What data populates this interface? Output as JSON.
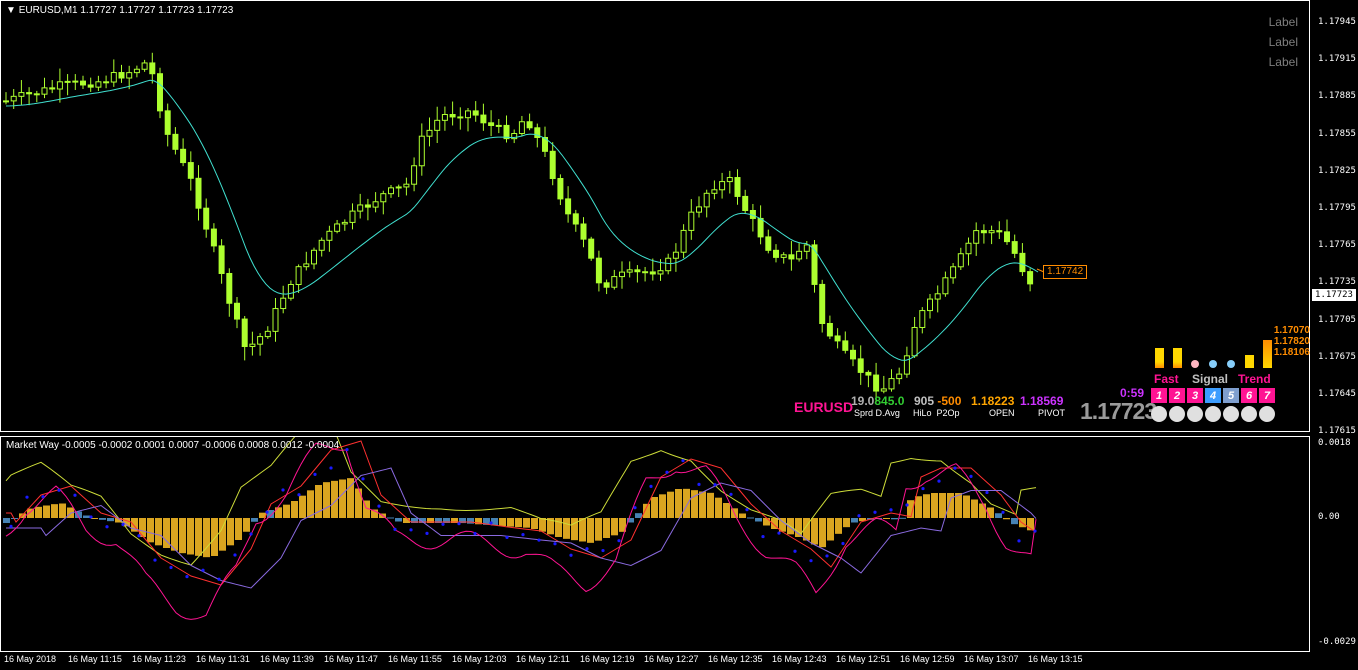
{
  "main_header": {
    "arrow": "▼",
    "text": "EURUSD,M1  1.17727 1.17727 1.17723 1.17723"
  },
  "sub_header": {
    "text": "Market Way -0.0005 -0.0002 0.0001 0.0007 -0.0006 0.0008 0.0012 -0.0004"
  },
  "labels": [
    "Label",
    "Label",
    "Label"
  ],
  "price_axis": [
    "1.17945",
    "1.17915",
    "1.17885",
    "1.17855",
    "1.17825",
    "1.17795",
    "1.17765",
    "1.17735",
    "1.17705",
    "1.17675",
    "1.17645",
    "1.17615"
  ],
  "current_price": "1.17723",
  "sub_axis": [
    "0.0018",
    "0.00",
    "-0.0029"
  ],
  "time_axis": [
    "16 May 2018",
    "16 May 11:15",
    "16 May 11:23",
    "16 May 11:31",
    "16 May 11:39",
    "16 May 11:47",
    "16 May 11:55",
    "16 May 12:03",
    "16 May 12:11",
    "16 May 12:19",
    "16 May 12:27",
    "16 May 12:35",
    "16 May 12:43",
    "16 May 12:51",
    "16 May 12:59",
    "16 May 13:07",
    "16 May 13:15"
  ],
  "price_tag": "1.17742",
  "info_panel": {
    "symbol": "EURUSD",
    "sprd_value": "19.0",
    "davg_value": "845.0",
    "sprd_label": "Sprd",
    "davg_label": "D.Avg",
    "hilo_value": "905",
    "p2op_value": "-500",
    "hilo_label": "HiLo",
    "p2op_label": "P2Op",
    "open_value": "1.18223",
    "open_label": "OPEN",
    "pivot_value": "1.18569",
    "pivot_label": "PIVOT",
    "timer": "0:59",
    "big_price": "1.17723"
  },
  "signal_panel": {
    "levels": [
      "1.17070",
      "1.17820",
      "1.18106"
    ],
    "fast_label": "Fast",
    "signal_label": "Signal",
    "trend_label": "Trend",
    "numbers": [
      "1",
      "2",
      "3",
      "4",
      "5",
      "6",
      "7"
    ],
    "number_colors": [
      "#ff1493",
      "#ff1493",
      "#ff1493",
      "#3c9dff",
      "#7f9fcf",
      "#ff1493",
      "#ff1493"
    ]
  },
  "colors": {
    "candle": "#adff2f",
    "ma": "#40e0d0",
    "hist_gold": "#daa520",
    "hist_blue": "#4682b4",
    "line_yellow": "#cddc39",
    "line_red": "#ff3030",
    "line_violet": "#8a6ae0",
    "line_magenta": "#ff1493",
    "dots": "#1a1aff"
  }
}
